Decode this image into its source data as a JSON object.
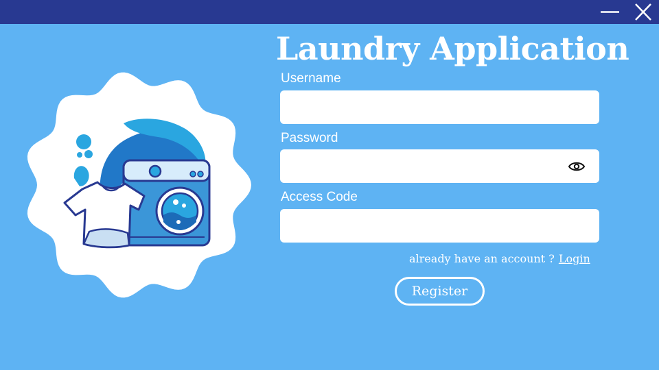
{
  "window": {
    "controls": [
      {
        "name": "minimize-button",
        "icon": "minimize-icon"
      },
      {
        "name": "close-button",
        "icon": "close-icon"
      }
    ]
  },
  "colors": {
    "titlebar": "#283991",
    "background": "#5eb3f3",
    "input_bg": "#ffffff",
    "text": "#ffffff"
  },
  "logo": {
    "icon": "washing-machine-laundry-logo"
  },
  "app_title": "Laundry Application",
  "form": {
    "username_label": "Username",
    "username_value": "",
    "password_label": "Password",
    "password_value": "",
    "password_toggle_icon": "eye-icon",
    "access_code_label": "Access Code",
    "access_code_value": ""
  },
  "footer": {
    "account_prompt": "already have an account ?",
    "login_link": "Login",
    "register_button": "Register"
  }
}
